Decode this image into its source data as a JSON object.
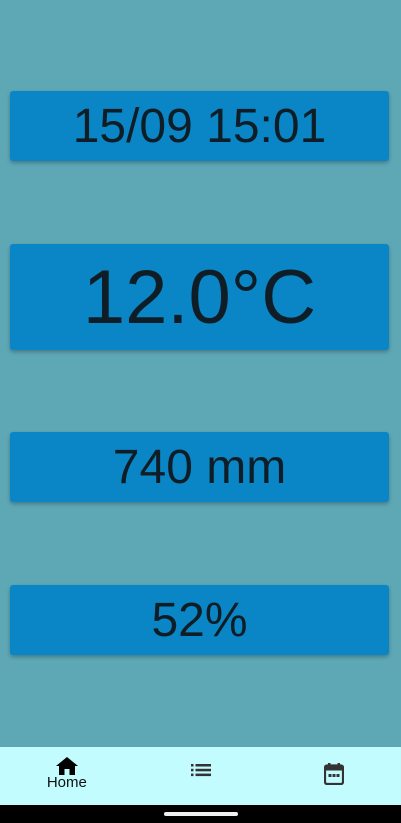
{
  "readings": {
    "datetime": "15/09 15:01",
    "temperature": "12.0°C",
    "pressure": "740 mm",
    "humidity": "52%"
  },
  "nav": {
    "items": [
      {
        "label": "Home",
        "icon": "home-icon",
        "selected": true
      },
      {
        "label": "",
        "icon": "list-icon",
        "selected": false
      },
      {
        "label": "",
        "icon": "calendar-icon",
        "selected": false
      }
    ]
  },
  "colors": {
    "background": "#5ea8b6",
    "card": "#0a86c6",
    "nav_background": "#c2fcff"
  }
}
